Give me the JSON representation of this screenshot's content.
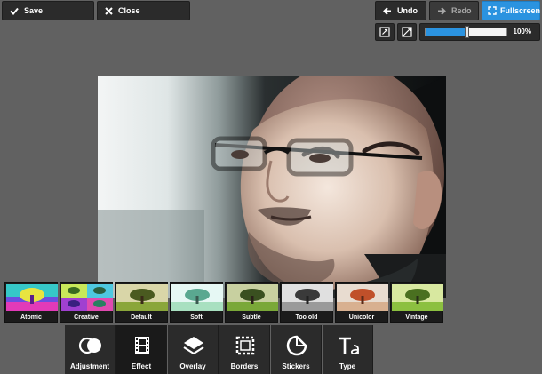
{
  "toolbar": {
    "save_label": "Save",
    "close_label": "Close",
    "undo_label": "Undo",
    "redo_label": "Redo",
    "fullscreen_label": "Fullscreen"
  },
  "zoom": {
    "value_label": "100%",
    "slider_fraction": 0.5
  },
  "effects": [
    {
      "label": "Atomic"
    },
    {
      "label": "Creative"
    },
    {
      "label": "Default"
    },
    {
      "label": "Soft"
    },
    {
      "label": "Subtle"
    },
    {
      "label": "Too old"
    },
    {
      "label": "Unicolor"
    },
    {
      "label": "Vintage"
    }
  ],
  "tools": [
    {
      "label": "Adjustment",
      "icon": "adjustment-icon"
    },
    {
      "label": "Effect",
      "icon": "film-icon"
    },
    {
      "label": "Overlay",
      "icon": "layers-icon"
    },
    {
      "label": "Borders",
      "icon": "frame-icon"
    },
    {
      "label": "Stickers",
      "icon": "sticker-icon"
    },
    {
      "label": "Type",
      "icon": "type-icon"
    }
  ],
  "colors": {
    "background": "#616161",
    "button": "#2b2b2b",
    "accent": "#2b93e0"
  }
}
